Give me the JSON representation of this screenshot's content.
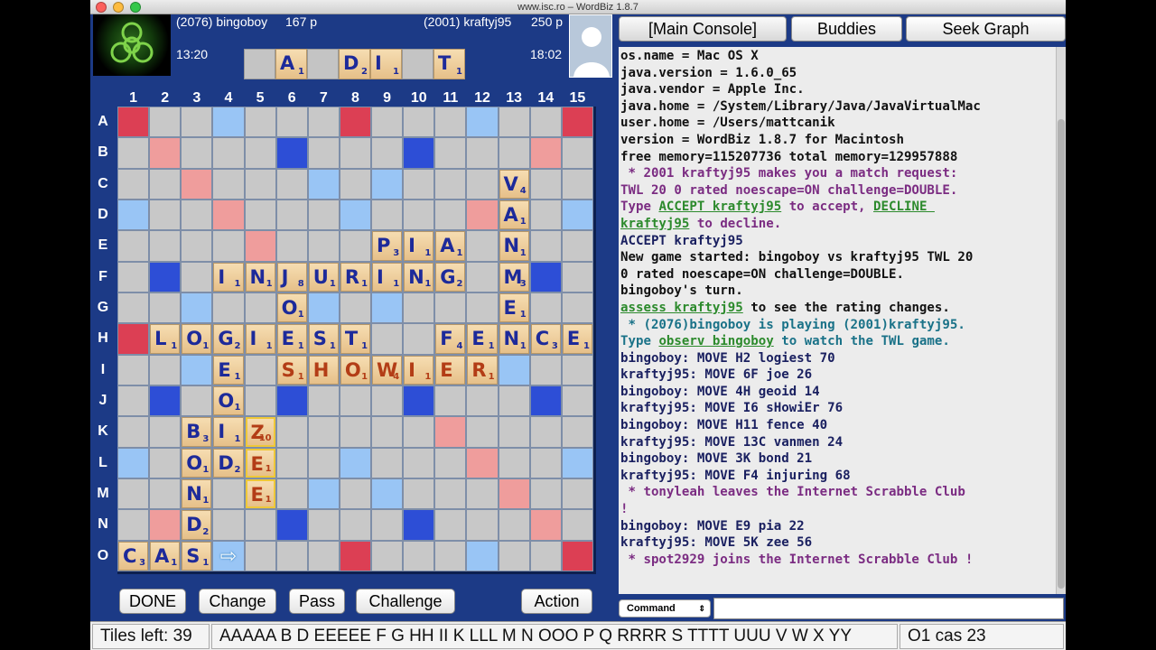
{
  "window": {
    "title": "www.isc.ro – WordBiz 1.8.7"
  },
  "players": {
    "left": {
      "label": "(2076) bingoboy",
      "score": "167 p",
      "clock": "13:20"
    },
    "right": {
      "label": "(2001) kraftyj95",
      "score": "250 p",
      "clock": "18:02"
    }
  },
  "rack": [
    {
      "letter": "",
      "value": ""
    },
    {
      "letter": "A",
      "value": "1"
    },
    {
      "letter": "",
      "value": ""
    },
    {
      "letter": "D",
      "value": "2"
    },
    {
      "letter": "I",
      "value": "1"
    },
    {
      "letter": "",
      "value": ""
    },
    {
      "letter": "T",
      "value": "1"
    }
  ],
  "board": {
    "columns": [
      "1",
      "2",
      "3",
      "4",
      "5",
      "6",
      "7",
      "8",
      "9",
      "10",
      "11",
      "12",
      "13",
      "14",
      "15"
    ],
    "rows": [
      "A",
      "B",
      "C",
      "D",
      "E",
      "F",
      "G",
      "H",
      "I",
      "J",
      "K",
      "L",
      "M",
      "N",
      "O"
    ],
    "premium_grid": [
      "R..b...R...b..R",
      ".D...T...T...D.",
      "..D...b.b...D..",
      "b..D...b...D..b",
      "....D.....D....",
      ".T...T...T...T.",
      "..b...b.b...b..",
      "R..b...D...b..R",
      "..b...b.b...b..",
      ".T...T...T...T.",
      "....D.....D....",
      "b..D...b...D..b",
      "..D...b.b...D..",
      ".D...T...T...D.",
      "R..b...R...b..R"
    ],
    "tiles": [
      {
        "r": 2,
        "c": 12,
        "letter": "V",
        "value": "4"
      },
      {
        "r": 3,
        "c": 12,
        "letter": "A",
        "value": "1"
      },
      {
        "r": 4,
        "c": 8,
        "letter": "P",
        "value": "3"
      },
      {
        "r": 4,
        "c": 9,
        "letter": "I",
        "value": "1"
      },
      {
        "r": 4,
        "c": 10,
        "letter": "A",
        "value": "1"
      },
      {
        "r": 4,
        "c": 12,
        "letter": "N",
        "value": "1"
      },
      {
        "r": 5,
        "c": 3,
        "letter": "I",
        "value": "1"
      },
      {
        "r": 5,
        "c": 4,
        "letter": "N",
        "value": "1"
      },
      {
        "r": 5,
        "c": 5,
        "letter": "J",
        "value": "8"
      },
      {
        "r": 5,
        "c": 6,
        "letter": "U",
        "value": "1"
      },
      {
        "r": 5,
        "c": 7,
        "letter": "R",
        "value": "1"
      },
      {
        "r": 5,
        "c": 8,
        "letter": "I",
        "value": "1"
      },
      {
        "r": 5,
        "c": 9,
        "letter": "N",
        "value": "1"
      },
      {
        "r": 5,
        "c": 10,
        "letter": "G",
        "value": "2"
      },
      {
        "r": 5,
        "c": 12,
        "letter": "M",
        "value": "3"
      },
      {
        "r": 6,
        "c": 5,
        "letter": "O",
        "value": "1"
      },
      {
        "r": 6,
        "c": 12,
        "letter": "E",
        "value": "1"
      },
      {
        "r": 7,
        "c": 1,
        "letter": "L",
        "value": "1"
      },
      {
        "r": 7,
        "c": 2,
        "letter": "O",
        "value": "1"
      },
      {
        "r": 7,
        "c": 3,
        "letter": "G",
        "value": "2"
      },
      {
        "r": 7,
        "c": 4,
        "letter": "I",
        "value": "1"
      },
      {
        "r": 7,
        "c": 5,
        "letter": "E",
        "value": "1"
      },
      {
        "r": 7,
        "c": 6,
        "letter": "S",
        "value": "1"
      },
      {
        "r": 7,
        "c": 7,
        "letter": "T",
        "value": "1"
      },
      {
        "r": 7,
        "c": 10,
        "letter": "F",
        "value": "4"
      },
      {
        "r": 7,
        "c": 11,
        "letter": "E",
        "value": "1"
      },
      {
        "r": 7,
        "c": 12,
        "letter": "N",
        "value": "1"
      },
      {
        "r": 7,
        "c": 13,
        "letter": "C",
        "value": "3"
      },
      {
        "r": 7,
        "c": 14,
        "letter": "E",
        "value": "1"
      },
      {
        "r": 8,
        "c": 3,
        "letter": "E",
        "value": "1"
      },
      {
        "r": 8,
        "c": 5,
        "letter": "S",
        "value": "1",
        "red": true
      },
      {
        "r": 8,
        "c": 6,
        "letter": "H",
        "value": "",
        "red": true
      },
      {
        "r": 8,
        "c": 7,
        "letter": "O",
        "value": "1",
        "red": true
      },
      {
        "r": 8,
        "c": 8,
        "letter": "W",
        "value": "4",
        "red": true
      },
      {
        "r": 8,
        "c": 9,
        "letter": "I",
        "value": "1",
        "red": true
      },
      {
        "r": 8,
        "c": 10,
        "letter": "E",
        "value": "",
        "red": true
      },
      {
        "r": 8,
        "c": 11,
        "letter": "R",
        "value": "1",
        "red": true
      },
      {
        "r": 9,
        "c": 3,
        "letter": "O",
        "value": "1"
      },
      {
        "r": 10,
        "c": 2,
        "letter": "B",
        "value": "3"
      },
      {
        "r": 10,
        "c": 3,
        "letter": "I",
        "value": "1"
      },
      {
        "r": 10,
        "c": 4,
        "letter": "Z",
        "value": "10",
        "red": true,
        "hl": true
      },
      {
        "r": 11,
        "c": 2,
        "letter": "O",
        "value": "1"
      },
      {
        "r": 11,
        "c": 3,
        "letter": "D",
        "value": "2"
      },
      {
        "r": 11,
        "c": 4,
        "letter": "E",
        "value": "1",
        "red": true,
        "hl": true
      },
      {
        "r": 12,
        "c": 2,
        "letter": "N",
        "value": "1"
      },
      {
        "r": 12,
        "c": 4,
        "letter": "E",
        "value": "1",
        "red": true,
        "hl": true
      },
      {
        "r": 13,
        "c": 2,
        "letter": "D",
        "value": "2"
      },
      {
        "r": 14,
        "c": 0,
        "letter": "C",
        "value": "3"
      },
      {
        "r": 14,
        "c": 1,
        "letter": "A",
        "value": "1"
      },
      {
        "r": 14,
        "c": 2,
        "letter": "S",
        "value": "1"
      }
    ],
    "cursor": {
      "r": 14,
      "c": 3,
      "glyph": "⇨"
    }
  },
  "buttons": {
    "done": "DONE",
    "change": "Change",
    "pass": "Pass",
    "challenge": "Challenge",
    "action": "Action"
  },
  "tabs": {
    "main": "[Main Console]",
    "buddies": "Buddies",
    "seek": "Seek Graph"
  },
  "console": [
    [
      {
        "t": "os.name = Mac OS X",
        "k": "sys"
      }
    ],
    [
      {
        "t": "java.version = 1.6.0_65",
        "k": "sys"
      }
    ],
    [
      {
        "t": "java.vendor = Apple Inc.",
        "k": "sys"
      }
    ],
    [
      {
        "t": "java.home = /System/Library/Java/JavaVirtualMac",
        "k": "sys"
      }
    ],
    [
      {
        "t": "user.home = /Users/mattcanik",
        "k": "sys"
      }
    ],
    [
      {
        "t": "version = WordBiz 1.8.7 for Macintosh",
        "k": "sys"
      }
    ],
    [
      {
        "t": "free memory=115207736 total memory=129957888",
        "k": "sys"
      }
    ],
    [
      {
        "t": " * 2001 kraftyj95 makes you a match request:",
        "k": "notice"
      }
    ],
    [
      {
        "t": "TWL 20 0 rated noescape=ON challenge=DOUBLE.",
        "k": "notice"
      }
    ],
    [
      {
        "t": "Type ",
        "k": "notice"
      },
      {
        "t": "ACCEPT kraftyj95",
        "k": "lnk"
      },
      {
        "t": " to accept, ",
        "k": "notice"
      },
      {
        "t": "DECLINE ",
        "k": "lnk"
      }
    ],
    [
      {
        "t": "kraftyj95",
        "k": "lnk"
      },
      {
        "t": " to decline.",
        "k": "notice"
      }
    ],
    [
      {
        "t": "ACCEPT kraftyj95",
        "k": "mv"
      }
    ],
    [
      {
        "t": "New game started: bingoboy vs kraftyj95 TWL 20",
        "k": "sys"
      }
    ],
    [
      {
        "t": "0 rated noescape=ON challenge=DOUBLE.",
        "k": "sys"
      }
    ],
    [
      {
        "t": "bingoboy's turn.",
        "k": "sys"
      }
    ],
    [
      {
        "t": "assess kraftyj95",
        "k": "lnk"
      },
      {
        "t": " to see the rating changes.",
        "k": "sys"
      }
    ],
    [
      {
        "t": " * (2076)bingoboy is playing (2001)kraftyj95.",
        "k": "prompt"
      }
    ],
    [
      {
        "t": "Type ",
        "k": "prompt"
      },
      {
        "t": "observ bingoboy",
        "k": "lnk"
      },
      {
        "t": " to watch the TWL game.",
        "k": "prompt"
      }
    ],
    [
      {
        "t": "bingoboy: MOVE H2 logiest 70",
        "k": "mv"
      }
    ],
    [
      {
        "t": "kraftyj95: MOVE 6F joe 26",
        "k": "mv"
      }
    ],
    [
      {
        "t": "bingoboy: MOVE 4H geoid 14",
        "k": "mv"
      }
    ],
    [
      {
        "t": "kraftyj95: MOVE I6 sHowiEr 76",
        "k": "mv"
      }
    ],
    [
      {
        "t": "bingoboy: MOVE H11 fence 40",
        "k": "mv"
      }
    ],
    [
      {
        "t": "kraftyj95: MOVE 13C vanmen 24",
        "k": "mv"
      }
    ],
    [
      {
        "t": "bingoboy: MOVE 3K bond 21",
        "k": "mv"
      }
    ],
    [
      {
        "t": "kraftyj95: MOVE F4 injuring 68",
        "k": "mv"
      }
    ],
    [
      {
        "t": " * tonyleah leaves the Internet Scrabble Club",
        "k": "notice"
      }
    ],
    [
      {
        "t": "!",
        "k": "notice"
      }
    ],
    [
      {
        "t": "bingoboy: MOVE E9 pia 22",
        "k": "mv"
      }
    ],
    [
      {
        "t": "kraftyj95: MOVE 5K zee 56",
        "k": "mv"
      }
    ],
    [
      {
        "t": " * spot2929 joins the Internet Scrabble Club !",
        "k": "notice"
      }
    ]
  ],
  "command": {
    "selector": "Command"
  },
  "status": {
    "tiles_left": "Tiles left: 39",
    "unseen": "AAAAA B D EEEEE F G HH II K LLL M N OOO P Q RRRR S TTTT UUU V W X YY",
    "last_move": "O1 cas 23"
  },
  "colors": {
    "tw": "#dc3f54",
    "dw": "#ef9d9c",
    "tl": "#2d4ed6",
    "dl": "#99c5f5",
    "plain": "#c8c8c8",
    "frame": "#1c3a86"
  }
}
